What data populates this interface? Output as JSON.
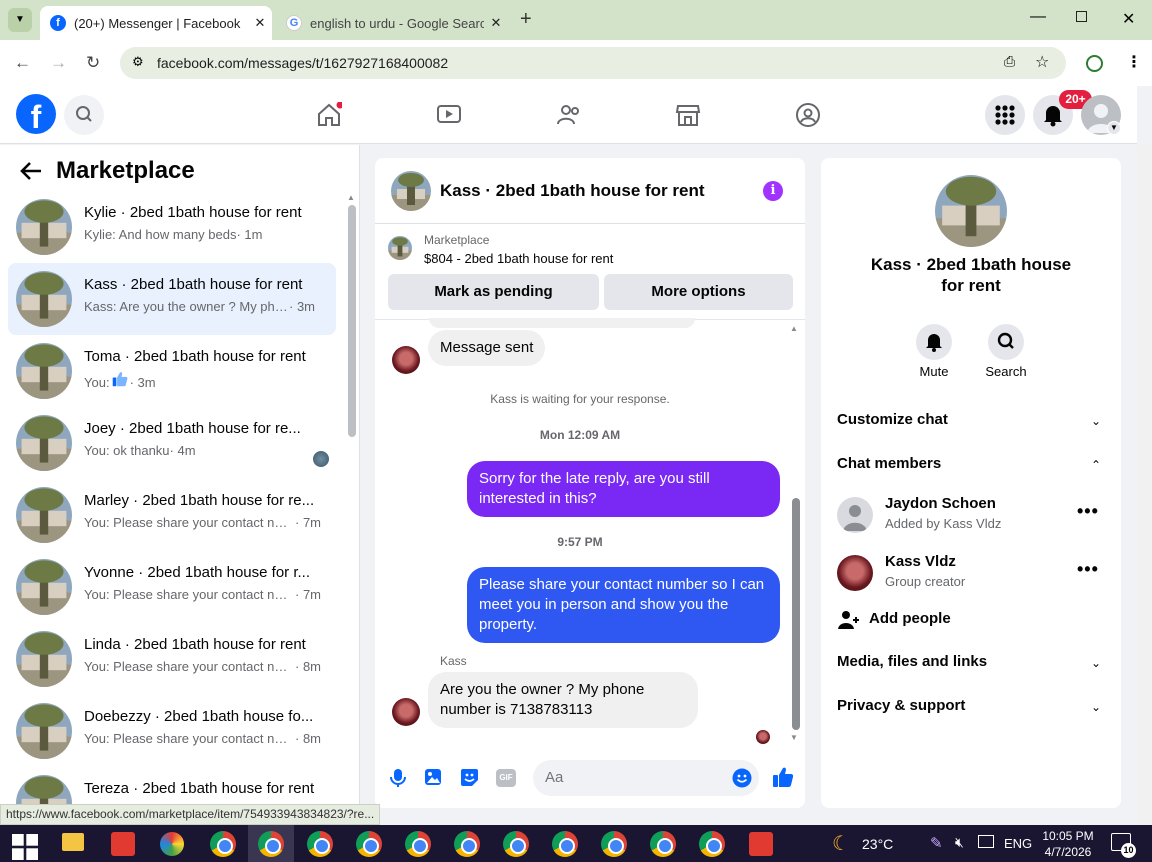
{
  "browser": {
    "tabs": [
      {
        "title": "(20+) Messenger | Facebook",
        "active": true
      },
      {
        "title": "english to urdu - Google Search",
        "active": false
      }
    ],
    "url": "facebook.com/messages/t/1627927168400082",
    "status_url": "https://www.facebook.com/marketplace/item/754933943834823/?re..."
  },
  "header": {
    "notification_badge": "20+",
    "brand_color": "#0866ff"
  },
  "sidebar": {
    "title": "Marketplace",
    "conversations": [
      {
        "name": "Kylie · 2bed 1bath house for rent",
        "preview": "Kylie: And how many beds",
        "time": "· 1m",
        "selected": false
      },
      {
        "name": "Kass · 2bed 1bath house for rent",
        "preview": "Kass: Are you the owner ? My pho...",
        "time": "· 3m",
        "selected": true
      },
      {
        "name": "Toma · 2bed 1bath house for rent",
        "preview": "You:",
        "time": "· 3m",
        "selected": false
      },
      {
        "name": "Joey · 2bed 1bath house for re...",
        "preview": "You: ok thanku",
        "time": "· 4m",
        "selected": false
      },
      {
        "name": "Marley · 2bed 1bath house for re...",
        "preview": "You: Please share your contact nu...",
        "time": "· 7m",
        "selected": false
      },
      {
        "name": "Yvonne · 2bed 1bath house for r...",
        "preview": "You: Please share your contact nu...",
        "time": "· 7m",
        "selected": false
      },
      {
        "name": "Linda · 2bed 1bath house for rent",
        "preview": "You: Please share your contact nu...",
        "time": "· 8m",
        "selected": false
      },
      {
        "name": "Doebezzy · 2bed 1bath house fo...",
        "preview": "You: Please share your contact nu...",
        "time": "· 8m",
        "selected": false
      },
      {
        "name": "Tereza · 2bed 1bath house for rent",
        "preview": "",
        "time": "",
        "selected": false
      }
    ]
  },
  "chat": {
    "title": "Kass · 2bed 1bath house for rent",
    "marketplace_label": "Marketplace",
    "listing": "$804 - 2bed 1bath house for rent",
    "mark_pending_label": "Mark as pending",
    "more_options_label": "More options",
    "messages": {
      "incoming_1": "Message sent",
      "waiting_notice": "Kass is waiting for your response.",
      "timestamp_1": "Mon 12:09 AM",
      "outgoing_1": "Sorry for the late reply, are you still interested in this?",
      "timestamp_2": "9:57 PM",
      "outgoing_2": "Please share your contact number so I can meet you in person and show you the property.",
      "sender_name": "Kass",
      "incoming_2": "Are you the owner ? My phone number is 7138783113"
    },
    "composer_placeholder": "Aa",
    "accent_color": "#0866ff"
  },
  "details": {
    "name": "Kass · 2bed 1bath house for rent",
    "mute_label": "Mute",
    "search_label": "Search",
    "customize_label": "Customize chat",
    "members_label": "Chat members",
    "members": [
      {
        "name": "Jaydon Schoen",
        "sub": "Added by Kass Vldz"
      },
      {
        "name": "Kass Vldz",
        "sub": "Group creator"
      }
    ],
    "add_people_label": "Add people",
    "media_label": "Media, files and links",
    "privacy_label": "Privacy & support"
  },
  "taskbar": {
    "temperature": "23°C",
    "language": "ENG",
    "time": "10:05 PM",
    "date": "4/7/2026",
    "notification_count": "10"
  }
}
